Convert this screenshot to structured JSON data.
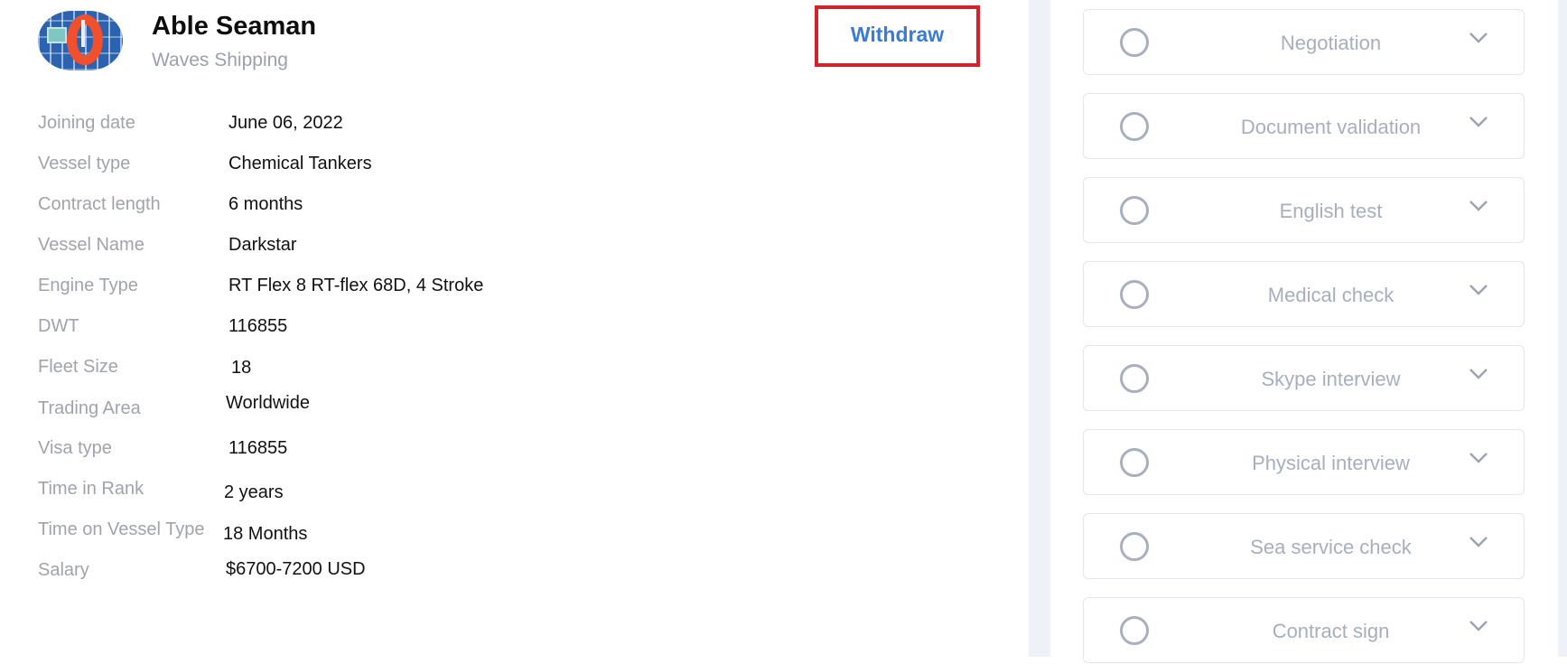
{
  "job": {
    "title": "Able Seaman",
    "company": "Waves Shipping",
    "avatar_icon": "life-ring-image",
    "withdraw_label": "Withdraw"
  },
  "fields": [
    {
      "label": "Joining date",
      "value": "June 06, 2022"
    },
    {
      "label": "Vessel type",
      "value": "Chemical Tankers"
    },
    {
      "label": "Contract length",
      "value": "6 months"
    },
    {
      "label": "Vessel Name",
      "value": "Darkstar"
    },
    {
      "label": "Engine Type",
      "value": "RT Flex 8 RT-flex 68D, 4 Stroke"
    },
    {
      "label": "DWT",
      "value": "116855"
    },
    {
      "label": "Fleet Size",
      "value": "18"
    },
    {
      "label": "Trading Area",
      "value": "Worldwide"
    },
    {
      "label": "Visa type",
      "value": "116855"
    },
    {
      "label": "Time in Rank",
      "value": "2 years"
    },
    {
      "label": "Time on Vessel Type",
      "value": "18 Months"
    },
    {
      "label": "Salary",
      "value": "$6700-7200 USD"
    }
  ],
  "stages": [
    {
      "label": "Negotiation",
      "status_icon": "empty-circle-icon",
      "expand_icon": "chevron-down-icon"
    },
    {
      "label": "Document validation",
      "status_icon": "empty-circle-icon",
      "expand_icon": "chevron-down-icon"
    },
    {
      "label": "English test",
      "status_icon": "empty-circle-icon",
      "expand_icon": "chevron-down-icon"
    },
    {
      "label": "Medical check",
      "status_icon": "empty-circle-icon",
      "expand_icon": "chevron-down-icon"
    },
    {
      "label": "Skype interview",
      "status_icon": "empty-circle-icon",
      "expand_icon": "chevron-down-icon"
    },
    {
      "label": "Physical interview",
      "status_icon": "empty-circle-icon",
      "expand_icon": "chevron-down-icon"
    },
    {
      "label": "Sea service check",
      "status_icon": "empty-circle-icon",
      "expand_icon": "chevron-down-icon"
    },
    {
      "label": "Contract sign",
      "status_icon": "empty-circle-icon",
      "expand_icon": "chevron-down-icon"
    }
  ],
  "colors": {
    "withdraw_text": "#3a7bd5",
    "withdraw_highlight_border": "#d4222c",
    "label_gray": "#a0a4aa",
    "stage_gray": "#a6afbe",
    "panel_separator": "#eef2f8"
  }
}
